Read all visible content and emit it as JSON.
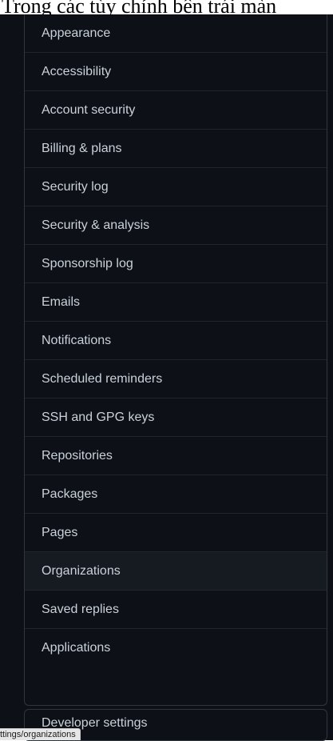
{
  "caption": "Trong các tùy chỉnh bên trái màn",
  "menu": {
    "items": [
      {
        "label": "Appearance"
      },
      {
        "label": "Accessibility"
      },
      {
        "label": "Account security"
      },
      {
        "label": "Billing & plans"
      },
      {
        "label": "Security log"
      },
      {
        "label": "Security & analysis"
      },
      {
        "label": "Sponsorship log"
      },
      {
        "label": "Emails"
      },
      {
        "label": "Notifications"
      },
      {
        "label": "Scheduled reminders"
      },
      {
        "label": "SSH and GPG keys"
      },
      {
        "label": "Repositories"
      },
      {
        "label": "Packages"
      },
      {
        "label": "Pages"
      },
      {
        "label": "Organizations"
      },
      {
        "label": "Saved replies"
      },
      {
        "label": "Applications"
      }
    ]
  },
  "developer": {
    "label": "Developer settings"
  },
  "status_bar": {
    "url": "ttings/organizations"
  },
  "colors": {
    "background": "#0d1117",
    "border": "#30363d",
    "text": "#c9d1d9",
    "hover_background": "#161b22"
  }
}
